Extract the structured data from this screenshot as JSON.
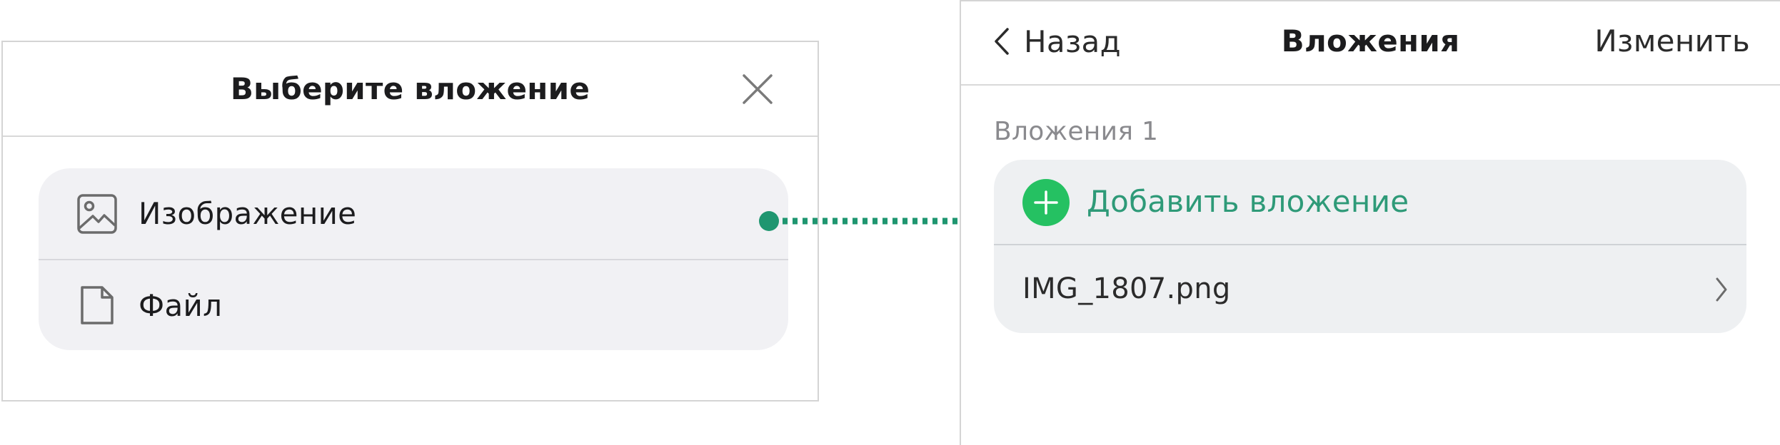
{
  "dialog": {
    "title": "Выберите вложение",
    "options": [
      {
        "label": "Изображение",
        "icon": "image-icon"
      },
      {
        "label": "Файл",
        "icon": "file-icon"
      }
    ]
  },
  "screen": {
    "back_label": "Назад",
    "title": "Вложения",
    "action_label": "Изменить",
    "section_title": "Вложения 1",
    "add_label": "Добавить вложение",
    "attachments": [
      {
        "name": "IMG_1807.png"
      }
    ]
  },
  "colors": {
    "accent": "#2e9a78",
    "plus_button": "#25c162",
    "connector": "#1f9670"
  }
}
